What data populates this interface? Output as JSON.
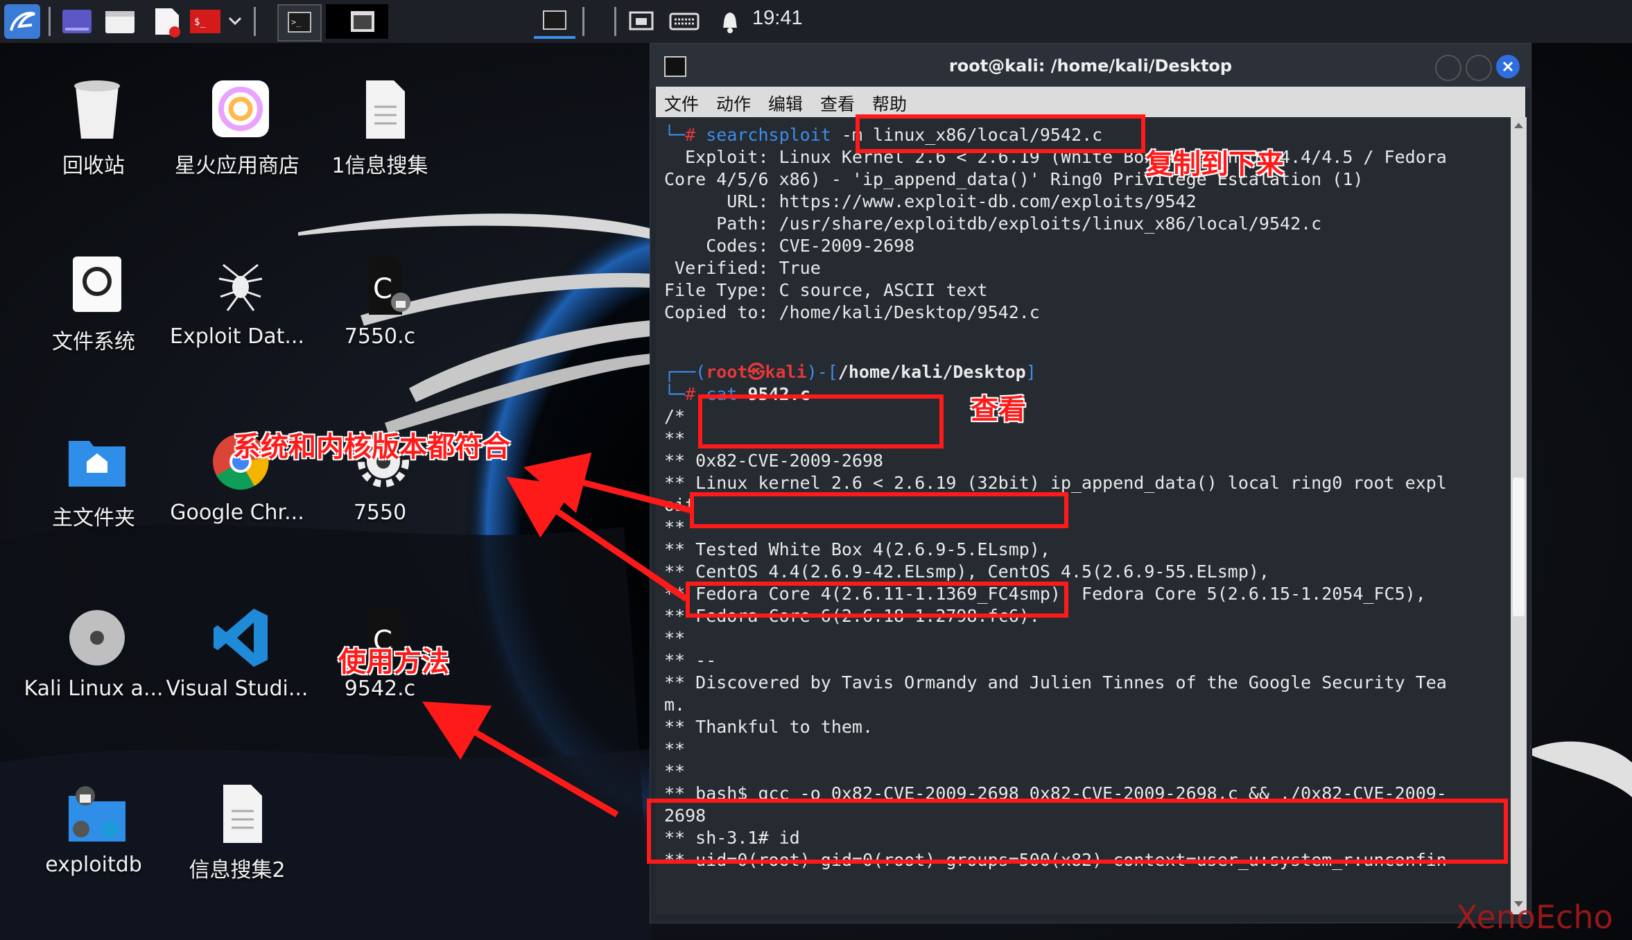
{
  "taskbar": {
    "clock": "19:41",
    "icons": [
      "kali-dragon-icon",
      "workspace-icon",
      "files-icon",
      "text-editor-icon",
      "terminal-red-icon",
      "dropdown-icon",
      "terminal-window-icon",
      "window-icon",
      "terminal-small-icon",
      "network-icon",
      "keyboard-icon",
      "bell-icon"
    ]
  },
  "desktop": {
    "icons": [
      {
        "label": "回收站"
      },
      {
        "label": "星火应用商店"
      },
      {
        "label": "1信息搜集"
      },
      {
        "label": "文件系统"
      },
      {
        "label": "Exploit Dat..."
      },
      {
        "label": "7550.c"
      },
      {
        "label": "主文件夹"
      },
      {
        "label": "Google Chr..."
      },
      {
        "label": "7550"
      },
      {
        "label": "Kali Linux a..."
      },
      {
        "label": "Visual Studi..."
      },
      {
        "label": "9542.c"
      },
      {
        "label": "exploitdb"
      },
      {
        "label": "信息搜集2"
      }
    ]
  },
  "terminal": {
    "title": "root@kali: /home/kali/Desktop",
    "menu": [
      "文件",
      "动作",
      "编辑",
      "查看",
      "帮助"
    ],
    "lines": {
      "l1_prompt": "└─",
      "l1_hash": "# ",
      "l1_cmd": "searchsploit ",
      "l1_arg": "-m linux_x86/local/9542.c",
      "l2": "  Exploit: Linux Kernel 2.6 < 2.6.19 (White Box 4 / CentOS 4.4/4.5 / Fedora",
      "l3": "Core 4/5/6 x86) - 'ip_append_data()' Ring0 Privilege Escalation (1)",
      "l4": "      URL: https://www.exploit-db.com/exploits/9542",
      "l5": "     Path: /usr/share/exploitdb/exploits/linux_x86/local/9542.c",
      "l6": "    Codes: CVE-2009-2698",
      "l7": " Verified: True",
      "l8": "File Type: C source, ASCII text",
      "l9": "Copied to: /home/kali/Desktop/9542.c",
      "p1_a": "┌──(",
      "p1_user": "root㉿kali",
      "p1_b": ")-[",
      "p1_path": "/home/kali/Desktop",
      "p1_c": "]",
      "p2_a": "└─",
      "p2_hash": "# ",
      "p2_cmd": "cat ",
      "p2_arg": "9542.c",
      "c1": "/*",
      "c2": "**",
      "c3": "** 0x82-CVE-2009-2698",
      "c4": "** Linux kernel 2.6 < 2.6.19 (32bit) ip_append_data() local ring0 root expl",
      "c5": "oit",
      "c6": "**",
      "c7": "** Tested White Box 4(2.6.9-5.ELsmp),",
      "c8": "** CentOS 4.4(2.6.9-42.ELsmp), CentOS 4.5(2.6.9-55.ELsmp),",
      "c9": "** Fedora Core 4(2.6.11-1.1369_FC4smp), Fedora Core 5(2.6.15-1.2054_FC5),",
      "c10": "** Fedora Core 6(2.6.18-1.2798.fc6).",
      "c11": "**",
      "c12": "** --",
      "c13": "** Discovered by Tavis Ormandy and Julien Tinnes of the Google Security Tea",
      "c14": "m.",
      "c15": "** Thankful to them.",
      "c16": "**",
      "c17": "**",
      "c18": "** bash$ gcc -o 0x82-CVE-2009-2698 0x82-CVE-2009-2698.c && ./0x82-CVE-2009-",
      "c19": "2698",
      "c20": "** sh-3.1# id",
      "c21": "** uid=0(root) gid=0(root) groups=500(x82) context=user_u:system_r:unconfin"
    }
  },
  "annotations": {
    "copy_down": "复制到下来",
    "view": "查看",
    "version_match": "系统和内核版本都符合",
    "usage": "使用方法",
    "color": "#ff1a1a"
  },
  "watermark": "XenoEcho"
}
